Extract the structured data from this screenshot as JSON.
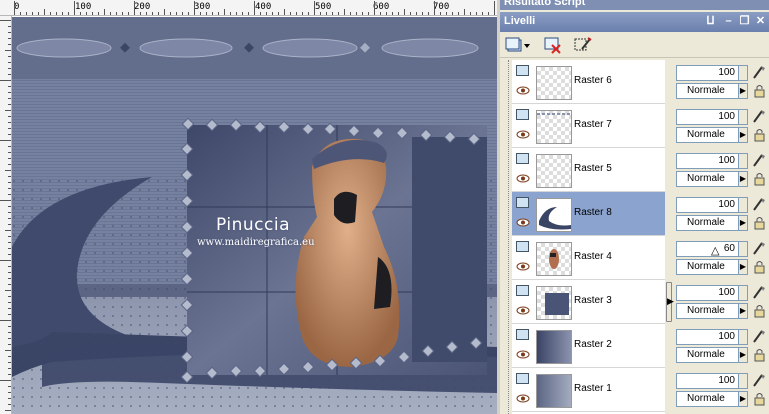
{
  "script_bar": {
    "title": "Risultato Script"
  },
  "panel": {
    "title": "Livelli",
    "pin_label": "⨿",
    "minimize_label": "–",
    "restore_label": "❐",
    "close_label": "✕"
  },
  "ruler": {
    "top_labels": [
      "0",
      "100",
      "200",
      "300",
      "400",
      "500",
      "600",
      "700"
    ]
  },
  "watermark": {
    "title": "Pinuccia",
    "url": "www.maidiregrafica.eu"
  },
  "layers": [
    {
      "name": "Raster 6",
      "opacity": "100",
      "blend": "Normale",
      "selected": false
    },
    {
      "name": "Raster 7",
      "opacity": "100",
      "blend": "Normale",
      "selected": false
    },
    {
      "name": "Raster 5",
      "opacity": "100",
      "blend": "Normale",
      "selected": false
    },
    {
      "name": "Raster 8",
      "opacity": "100",
      "blend": "Normale",
      "selected": true
    },
    {
      "name": "Raster 4",
      "opacity": "60",
      "blend": "Normale",
      "selected": false
    },
    {
      "name": "Raster 3",
      "opacity": "100",
      "blend": "Normale",
      "selected": false
    },
    {
      "name": "Raster 2",
      "opacity": "100",
      "blend": "Normale",
      "selected": false
    },
    {
      "name": "Raster 1",
      "opacity": "100",
      "blend": "Normale",
      "selected": false
    }
  ],
  "icons": {
    "layer": "raster-layer-icon",
    "visibility": "eye-icon",
    "edit": "brush-icon",
    "lock": "lock-icon"
  }
}
